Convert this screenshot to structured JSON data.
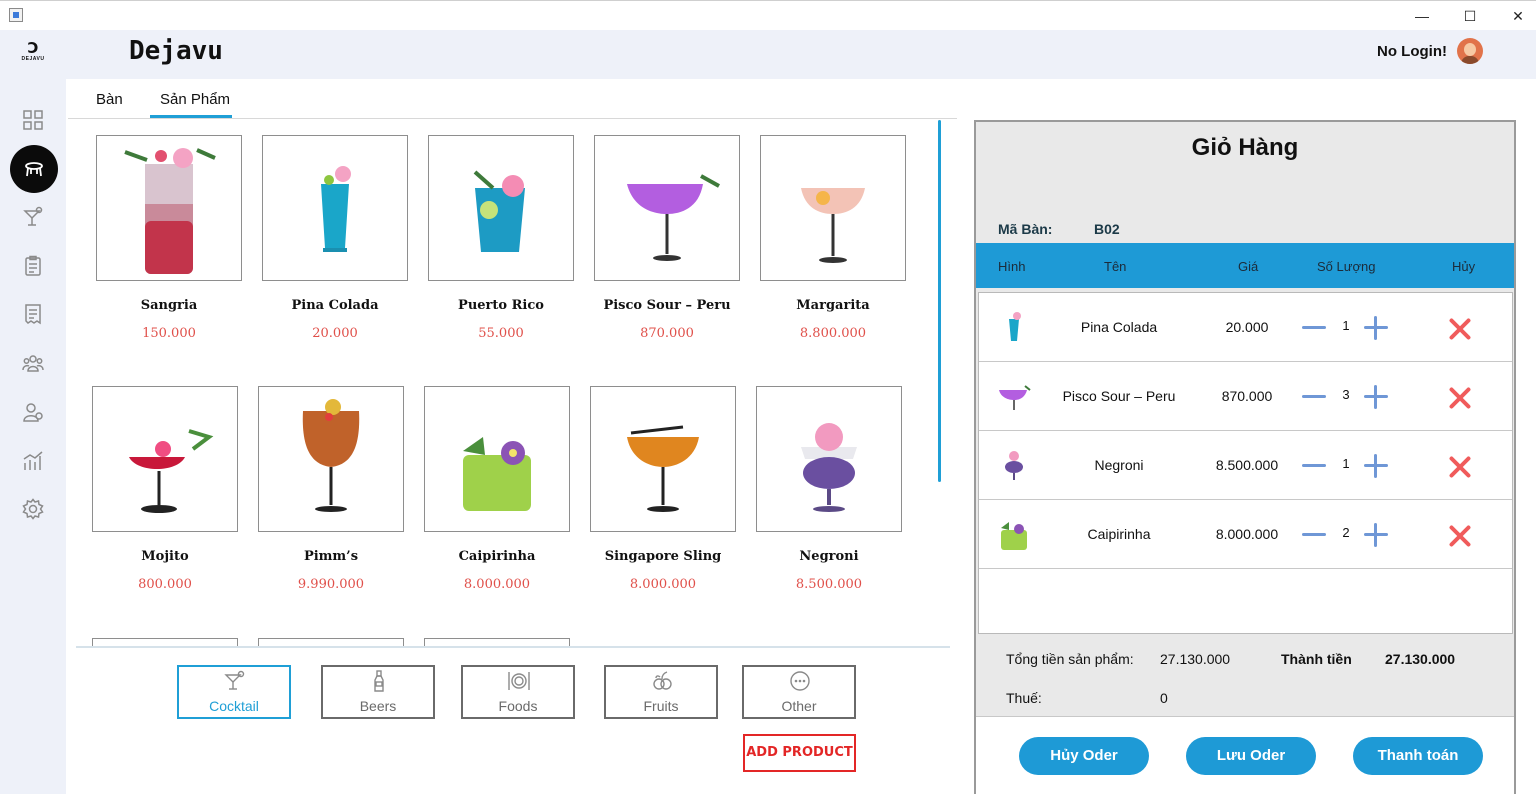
{
  "window": {
    "minimize": "—",
    "maximize": "☐",
    "close": "✕"
  },
  "brand": {
    "logo_text": "DEJAVU",
    "name": "Dejavu"
  },
  "user": {
    "login_status": "No Login!"
  },
  "sidebar": {
    "items": [
      "dashboard-icon",
      "table-icon",
      "cocktail-icon",
      "clipboard-icon",
      "receipt-icon",
      "customers-icon",
      "staff-icon",
      "stats-icon",
      "settings-icon"
    ],
    "active": "table-icon"
  },
  "tabs": [
    {
      "label": "Bàn"
    },
    {
      "label": "Sản Phẩm"
    }
  ],
  "products": [
    {
      "name": "Sangria",
      "price": "150.000"
    },
    {
      "name": "Pina Colada",
      "price": "20.000"
    },
    {
      "name": "Puerto Rico",
      "price": "55.000"
    },
    {
      "name": "Pisco Sour – Peru",
      "price": "870.000"
    },
    {
      "name": "Margarita",
      "price": "8.800.000"
    },
    {
      "name": "Mojito",
      "price": "800.000"
    },
    {
      "name": "Pimm’s",
      "price": "9.990.000"
    },
    {
      "name": "Caipirinha",
      "price": "8.000.000"
    },
    {
      "name": "Singapore Sling",
      "price": "8.000.000"
    },
    {
      "name": "Negroni",
      "price": "8.500.000"
    }
  ],
  "categories": [
    {
      "label": "Cocktail",
      "icon": "cocktail-icon"
    },
    {
      "label": "Beers",
      "icon": "beer-icon"
    },
    {
      "label": "Foods",
      "icon": "food-icon"
    },
    {
      "label": "Fruits",
      "icon": "fruit-icon"
    },
    {
      "label": "Other",
      "icon": "more-icon"
    }
  ],
  "add_product_label": "ADD PRODUCT",
  "cart": {
    "title": "Giỏ Hàng",
    "table_label": "Mã Bàn:",
    "table_value": "B02",
    "columns": [
      "Hình",
      "Tên",
      "Giá",
      "Số Lượng",
      "Hủy"
    ],
    "items": [
      {
        "name": "Pina Colada",
        "price": "20.000",
        "qty": "1"
      },
      {
        "name": "Pisco Sour – Peru",
        "price": "870.000",
        "qty": "3"
      },
      {
        "name": "Negroni",
        "price": "8.500.000",
        "qty": "1"
      },
      {
        "name": "Caipirinha",
        "price": "8.000.000",
        "qty": "2"
      }
    ],
    "subtotal_label": "Tổng tiền sản phẩm:",
    "subtotal_value": "27.130.000",
    "total_label": "Thành tiền",
    "total_value": "27.130.000",
    "tax_label": "Thuế:",
    "tax_value": "0",
    "buttons": {
      "cancel": "Hủy Oder",
      "save": "Lưu Oder",
      "pay": "Thanh toán"
    }
  },
  "colors": {
    "accent": "#1e9ad6",
    "price": "#e0504a",
    "delete": "#f05b5b",
    "add_product": "#e32626"
  }
}
